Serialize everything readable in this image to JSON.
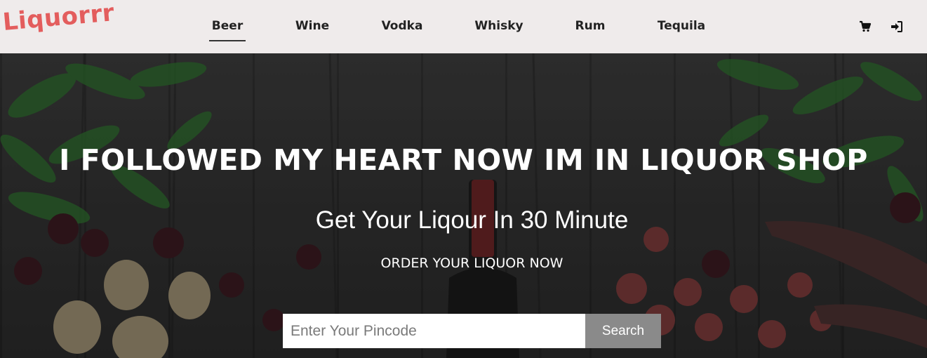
{
  "brand": {
    "logo_text": "Liquorrr",
    "logo_color": "#e35d5d"
  },
  "nav": {
    "items": [
      {
        "label": "Beer",
        "active": true
      },
      {
        "label": "Wine",
        "active": false
      },
      {
        "label": "Vodka",
        "active": false
      },
      {
        "label": "Whisky",
        "active": false
      },
      {
        "label": "Rum",
        "active": false
      },
      {
        "label": "Tequila",
        "active": false
      }
    ],
    "icons": [
      "cart-icon",
      "sign-in-icon"
    ]
  },
  "hero": {
    "title": "I FOLLOWED MY HEART NOW IM IN LIQUOR SHOP",
    "subtitle": "Get Your Liqour In 30 Minute",
    "cta": "ORDER YOUR LIQUOR NOW",
    "search": {
      "placeholder": "Enter Your Pincode",
      "value": "",
      "button_label": "Search"
    }
  },
  "colors": {
    "navbar_bg": "#efebeb",
    "button_bg": "#8a8a8a",
    "text_on_hero": "#ffffff"
  }
}
